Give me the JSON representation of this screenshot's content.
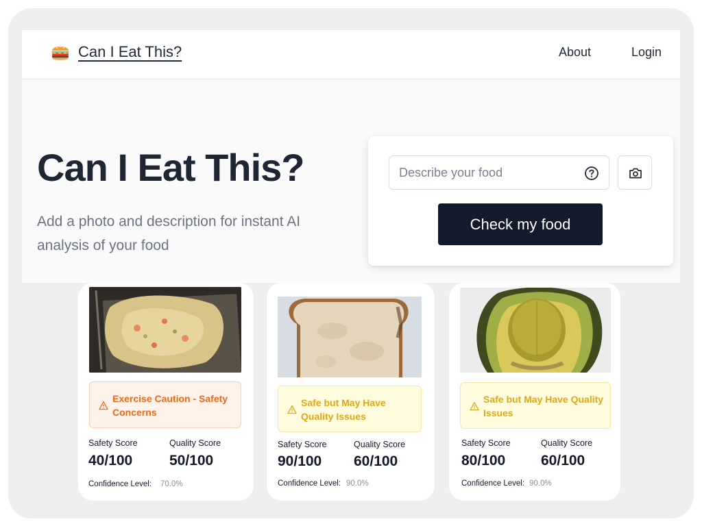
{
  "app": {
    "brand": "Can I Eat This?",
    "nav": {
      "about": "About",
      "login": "Login"
    }
  },
  "hero": {
    "title": "Can I Eat This?",
    "subtitle": "Add a photo and description for instant AI analysis of your food"
  },
  "form": {
    "placeholder": "Describe your food",
    "value": "",
    "submit_label": "Check my food",
    "icons": {
      "help": "question-circle-icon",
      "camera": "camera-icon"
    }
  },
  "results": [
    {
      "image": "leftover-pasta-salad-in-container",
      "status": "Exercise Caution - Safety Concerns",
      "status_level": "caution",
      "safety_label": "Safety Score",
      "safety": "40/100",
      "quality_label": "Quality Score",
      "quality": "50/100",
      "confidence_label": "Confidence Level:",
      "confidence": "70.0%"
    },
    {
      "image": "slice-of-bread",
      "status": "Safe but May Have Quality Issues",
      "status_level": "quality",
      "safety_label": "Safety Score",
      "safety": "90/100",
      "quality_label": "Quality Score",
      "quality": "60/100",
      "confidence_label": "Confidence Level:",
      "confidence": "90.0%"
    },
    {
      "image": "avocado-half",
      "status": "Safe but May Have Quality Issues",
      "status_level": "quality",
      "safety_label": "Safety Score",
      "safety": "80/100",
      "quality_label": "Quality Score",
      "quality": "60/100",
      "confidence_label": "Confidence Level:",
      "confidence": "90.0%"
    }
  ],
  "colors": {
    "caution": "#ea6a1a",
    "quality_warning": "#e0a812",
    "primary_button": "#121a2b"
  }
}
